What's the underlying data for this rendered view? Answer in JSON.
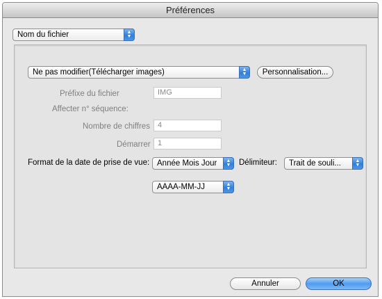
{
  "window": {
    "title": "Préférences"
  },
  "top_select": {
    "value": "Nom du fichier"
  },
  "panel": {
    "mode_select": {
      "value": "Ne pas modifier(Télécharger images)"
    },
    "customize_button": "Personnalisation...",
    "prefix": {
      "label": "Préfixe du fichier",
      "value": "IMG"
    },
    "sequence_label": "Affecter n° séquence:",
    "digits": {
      "label": "Nombre de chiffres",
      "value": "4"
    },
    "start": {
      "label": "Démarrer",
      "value": "1"
    },
    "date_format": {
      "label": "Format de la date de prise de vue:",
      "order_value": "Année Mois Jour",
      "pattern_value": "AAAA-MM-JJ"
    },
    "delimiter": {
      "label": "Délimiteur:",
      "value": "Trait de souli..."
    }
  },
  "buttons": {
    "cancel": "Annuler",
    "ok": "OK"
  }
}
